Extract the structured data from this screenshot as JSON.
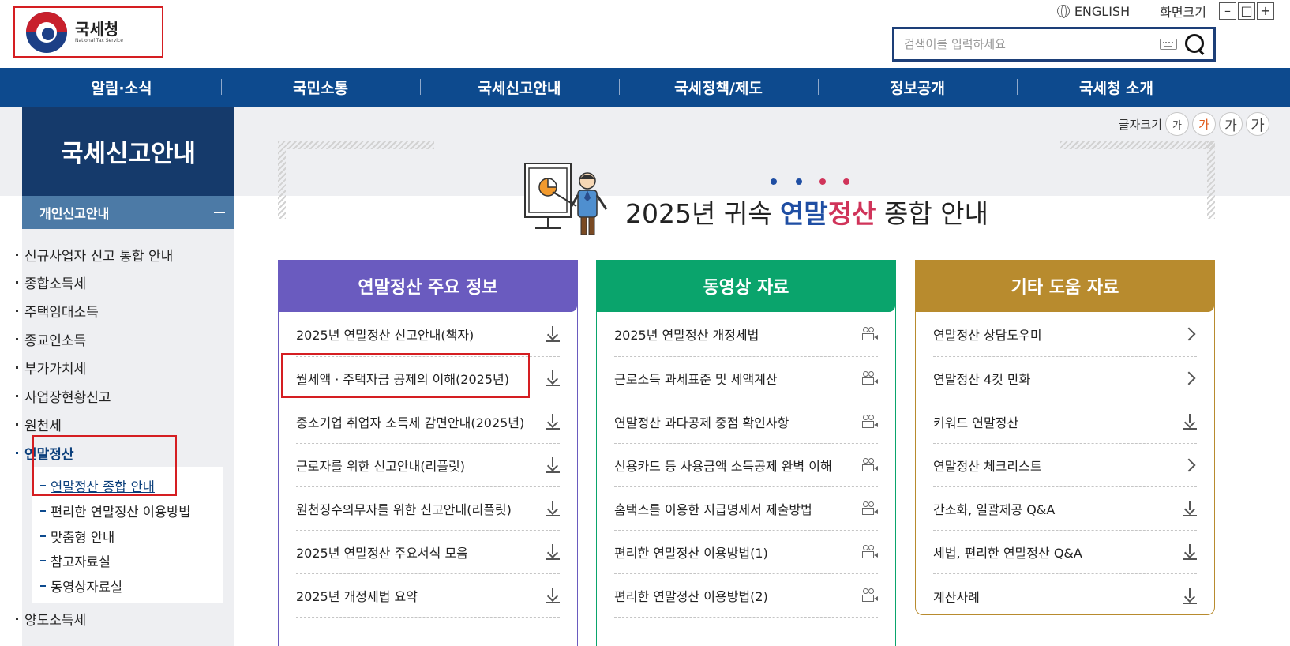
{
  "header": {
    "logo_ko": "국세청",
    "logo_en": "National Tax Service",
    "english": "ENGLISH",
    "screen_size": "화면크기",
    "zoom_out": "–",
    "zoom_reset": "□",
    "zoom_in": "+",
    "search_placeholder": "검색어를 입력하세요"
  },
  "gnb": [
    "알림·소식",
    "국민소통",
    "국세신고안내",
    "국세정책/제도",
    "정보공개",
    "국세청 소개"
  ],
  "sidebar": {
    "title": "국세신고안내",
    "section": "개인신고안내",
    "items": [
      "신규사업자 신고 통합 안내",
      "종합소득세",
      "주택임대소득",
      "종교인소득",
      "부가가치세",
      "사업장현황신고",
      "원천세",
      "연말정산",
      "양도소득세"
    ],
    "subitems": [
      "연말정산 종합 안내",
      "편리한 연말정산 이용방법",
      "맞춤형 안내",
      "참고자료실",
      "동영상자료실"
    ]
  },
  "fontsize": {
    "label": "글자크기",
    "options": [
      "가",
      "가",
      "가",
      "가"
    ]
  },
  "hero": {
    "prefix": "2025년 귀속 ",
    "blue": "연말",
    "red": "정산",
    "suffix": " 종합 안내"
  },
  "colors": {
    "gnb": "#0d4a8e",
    "sidebar_title": "#153a6b",
    "card1": "#6a5bbf",
    "card2": "#0aa46c",
    "card3": "#b88b2e",
    "highlight": "#d51e22"
  },
  "cards": [
    {
      "title": "연말정산 주요 정보",
      "items": [
        {
          "label": "2025년 연말정산 신고안내(책자)",
          "icon": "download-icon"
        },
        {
          "label": "월세액 · 주택자금 공제의 이해(2025년)",
          "icon": "download-icon"
        },
        {
          "label": "중소기업 취업자 소득세 감면안내(2025년)",
          "icon": "download-icon"
        },
        {
          "label": "근로자를 위한 신고안내(리플릿)",
          "icon": "download-icon"
        },
        {
          "label": "원천징수의무자를 위한 신고안내(리플릿)",
          "icon": "download-icon"
        },
        {
          "label": "2025년 연말정산 주요서식 모음",
          "icon": "download-icon"
        },
        {
          "label": "2025년 개정세법 요약",
          "icon": "download-icon"
        }
      ]
    },
    {
      "title": "동영상 자료",
      "items": [
        {
          "label": "2025년 연말정산 개정세법",
          "icon": "video-icon"
        },
        {
          "label": "근로소득 과세표준 및 세액계산",
          "icon": "video-icon"
        },
        {
          "label": "연말정산 과다공제 중점 확인사항",
          "icon": "video-icon"
        },
        {
          "label": "신용카드 등 사용금액 소득공제 완벽 이해",
          "icon": "video-icon"
        },
        {
          "label": "홈택스를 이용한 지급명세서 제출방법",
          "icon": "video-icon"
        },
        {
          "label": "편리한 연말정산 이용방법(1)",
          "icon": "video-icon"
        },
        {
          "label": "편리한 연말정산 이용방법(2)",
          "icon": "video-icon"
        }
      ]
    },
    {
      "title": "기타 도움 자료",
      "items": [
        {
          "label": "연말정산 상담도우미",
          "icon": "chevron-right-icon"
        },
        {
          "label": "연말정산 4컷 만화",
          "icon": "chevron-right-icon"
        },
        {
          "label": "키워드 연말정산",
          "icon": "download-icon"
        },
        {
          "label": "연말정산 체크리스트",
          "icon": "chevron-right-icon"
        },
        {
          "label": "간소화, 일괄제공 Q&A",
          "icon": "download-icon"
        },
        {
          "label": "세법, 편리한 연말정산 Q&A",
          "icon": "download-icon"
        },
        {
          "label": "계산사례",
          "icon": "download-icon"
        }
      ]
    }
  ]
}
